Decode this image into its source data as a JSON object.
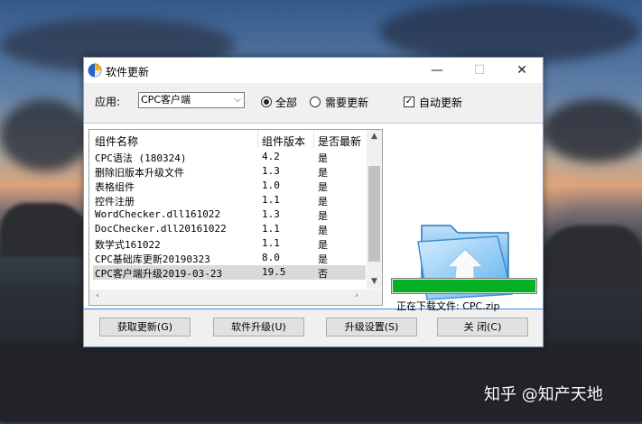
{
  "window": {
    "title": "软件更新",
    "controls": {
      "minimize": "—",
      "maximize": "☐",
      "close": "✕"
    }
  },
  "toolbar": {
    "app_label": "应用:",
    "app_selected": "CPC客户端",
    "radio_all": "全部",
    "radio_all_checked": true,
    "radio_need_update": "需要更新",
    "radio_need_update_checked": false,
    "auto_update_label": "自动更新",
    "auto_update_checked": true
  },
  "list": {
    "columns": [
      "组件名称",
      "组件版本",
      "是否最新"
    ],
    "rows": [
      {
        "name": "CPC语法 (180324)",
        "version": "4.2",
        "latest": "是"
      },
      {
        "name": "删除旧版本升级文件",
        "version": "1.3",
        "latest": "是"
      },
      {
        "name": "表格组件",
        "version": "1.0",
        "latest": "是"
      },
      {
        "name": "控件注册",
        "version": "1.1",
        "latest": "是"
      },
      {
        "name": "WordChecker.dll161022",
        "version": "1.3",
        "latest": "是"
      },
      {
        "name": "DocChecker.dll20161022",
        "version": "1.1",
        "latest": "是"
      },
      {
        "name": "数学式161022",
        "version": "1.1",
        "latest": "是"
      },
      {
        "name": "CPC基础库更新20190323",
        "version": "8.0",
        "latest": "是"
      },
      {
        "name": "CPC客户端升级2019-03-23",
        "version": "19.5",
        "latest": "否"
      }
    ],
    "selected_row": 8
  },
  "download": {
    "progress": 1.0,
    "status_text": "正在下载文件: CPC.zip"
  },
  "buttons": {
    "fetch": "获取更新(G)",
    "upgrade": "软件升级(U)",
    "settings": "升级设置(S)",
    "close": "关 闭(C)"
  },
  "watermark": "知乎 @知产天地",
  "colors": {
    "accent_border": "#3a8ee6",
    "progress_fill": "#06b025",
    "selected_row_bg": "#d9d9d9"
  },
  "icons": [
    "app-icon",
    "folder-upload-icon",
    "chevron-down-icon",
    "scroll-up-icon",
    "scroll-down-icon",
    "scroll-left-icon",
    "scroll-right-icon"
  ]
}
